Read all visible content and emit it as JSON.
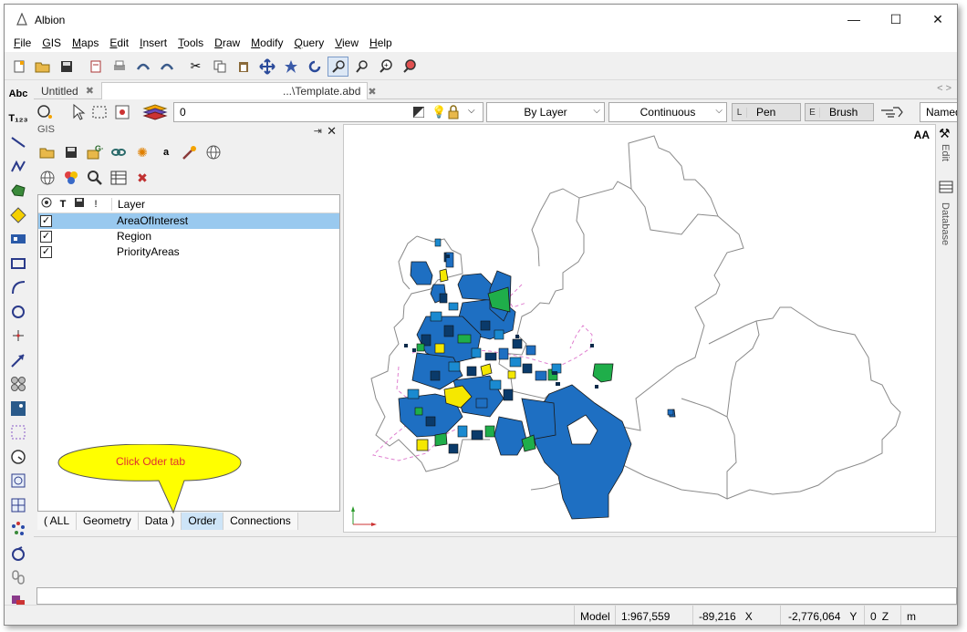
{
  "window": {
    "title": "Albion",
    "controls": {
      "minimize": "—",
      "maximize": "☐",
      "close": "✕"
    }
  },
  "menu": [
    "File",
    "GIS",
    "Maps",
    "Edit",
    "Insert",
    "Tools",
    "Draw",
    "Modify",
    "Query",
    "View",
    "Help"
  ],
  "toolbar": {
    "icons": [
      "new-icon",
      "open-icon",
      "save-icon",
      "print-preview-icon",
      "print-icon",
      "undo-icon",
      "redo-icon",
      "cut-icon",
      "copy-icon",
      "paste-icon",
      "pan-icon",
      "zoom-extents-icon",
      "refresh-icon",
      "zoom-window-icon",
      "zoom-previous-icon",
      "zoom-in-icon",
      "zoom-out-icon"
    ]
  },
  "doc_tabs": {
    "tab1": "Untitled",
    "tab2": "...\\Template.abd",
    "close_glyph": "✖",
    "scroll": "< >"
  },
  "layer_bar": {
    "layer_value": "0",
    "color": "By Layer",
    "linetype": "Continuous",
    "pen_key": "L",
    "pen_label": "Pen",
    "brush_key": "E",
    "brush_label": "Brush",
    "named": "Named"
  },
  "gis_panel": {
    "title": "GIS",
    "pin": "⇥",
    "close": "✕",
    "column_type": "T",
    "column_excl": "!",
    "column_layer": "Layer",
    "layers": [
      {
        "name": "AreaOfInterest",
        "checked": true,
        "selected": true
      },
      {
        "name": "Region",
        "checked": true,
        "selected": false
      },
      {
        "name": "PriorityAreas",
        "checked": true,
        "selected": false
      }
    ],
    "check_glyph": "✓",
    "bottom_tabs": [
      "( ALL",
      "Geometry",
      "Data )",
      "Order",
      "Connections"
    ]
  },
  "callout": {
    "text": "Click Oder tab"
  },
  "map": {
    "aa_label": "AA"
  },
  "side_panel": {
    "edit_label": "Edit",
    "database_label": "Database"
  },
  "status": {
    "model": "Model",
    "scale": "1:967,559",
    "x_value": "-89,216",
    "x_label": "X",
    "y_value": "-2,776,064",
    "y_label": "Y",
    "z_value": "0",
    "z_label": "Z",
    "unit": "m"
  },
  "colors": {
    "selection": "#99c9ef",
    "map_blue": "#1e6fc2",
    "map_green": "#1fae4a",
    "map_yellow": "#f5e800",
    "callout_fill": "#ffff00",
    "callout_text": "#e03030"
  }
}
